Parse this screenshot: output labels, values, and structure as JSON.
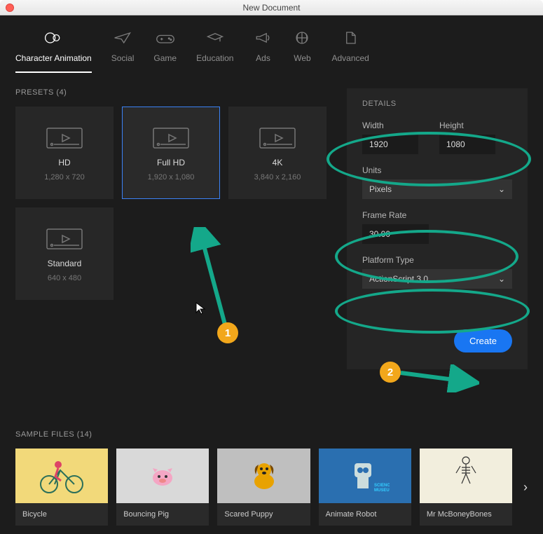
{
  "window": {
    "title": "New Document"
  },
  "tabs": [
    {
      "label": "Character Animation"
    },
    {
      "label": "Social"
    },
    {
      "label": "Game"
    },
    {
      "label": "Education"
    },
    {
      "label": "Ads"
    },
    {
      "label": "Web"
    },
    {
      "label": "Advanced"
    }
  ],
  "presets": {
    "heading": "PRESETS (4)",
    "items": [
      {
        "name": "HD",
        "dims": "1,280 x 720"
      },
      {
        "name": "Full HD",
        "dims": "1,920 x 1,080"
      },
      {
        "name": "4K",
        "dims": "3,840 x 2,160"
      },
      {
        "name": "Standard",
        "dims": "640 x 480"
      }
    ]
  },
  "details": {
    "heading": "DETAILS",
    "width_label": "Width",
    "width_value": "1920",
    "height_label": "Height",
    "height_value": "1080",
    "units_label": "Units",
    "units_value": "Pixels",
    "framerate_label": "Frame Rate",
    "framerate_value": "30.00",
    "platform_label": "Platform Type",
    "platform_value": "ActionScript 3.0",
    "create_label": "Create"
  },
  "samples": {
    "heading": "SAMPLE FILES (14)",
    "items": [
      {
        "name": "Bicycle"
      },
      {
        "name": "Bouncing Pig"
      },
      {
        "name": "Scared Puppy"
      },
      {
        "name": "Animate Robot"
      },
      {
        "name": "Mr McBoneyBones"
      }
    ]
  },
  "annotations": {
    "badge1": "1",
    "badge2": "2"
  }
}
